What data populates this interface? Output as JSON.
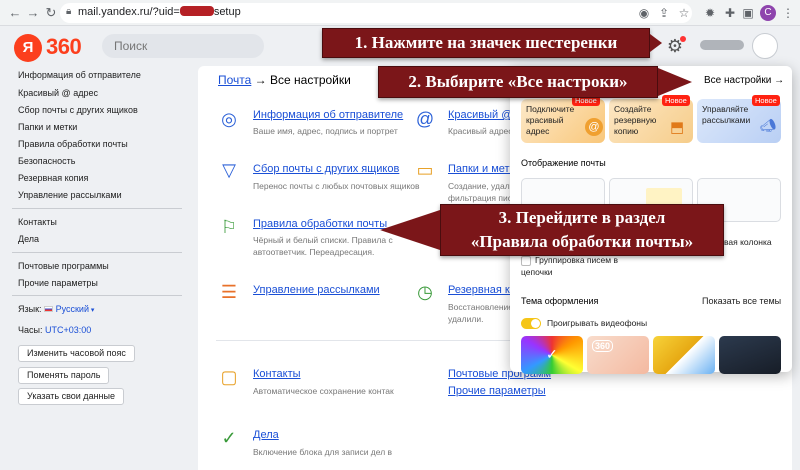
{
  "browser": {
    "url_prefix": "mail.yandex.ru/?uid=",
    "url_suffix": "setup",
    "profile_letter": "C"
  },
  "header": {
    "logo_letter": "Я",
    "logo_text": "360",
    "search_placeholder": "Поиск"
  },
  "sidebar": {
    "items": [
      "Информация об отправителе",
      "Красивый @ адрес",
      "Сбор почты с других ящиков",
      "Папки и метки",
      "Правила обработки почты",
      "Безопасность",
      "Резервная копия",
      "Управление рассылками"
    ],
    "items2": [
      "Контакты",
      "Дела"
    ],
    "items3": [
      "Почтовые программы",
      "Прочие параметры"
    ],
    "lang_label": "Язык:",
    "lang_value": "Русский",
    "tz_label": "Часы:",
    "tz_value": "UTC+03:00",
    "buttons": [
      "Изменить часовой пояс",
      "Поменять пароль",
      "Указать свои данные"
    ]
  },
  "breadcrumb": {
    "link": "Почта",
    "arrow": "→",
    "current": "Все настройки"
  },
  "settings": [
    {
      "title": "Информация об отправителе",
      "desc1": "Ваше имя, адрес, подпись и портрет",
      "desc2": ""
    },
    {
      "title": "Сбор почты с других ящиков",
      "desc1": "Перенос почты с любых почтовых ящиков",
      "desc2": ""
    },
    {
      "title": "Правила обработки почты",
      "desc1": "Чёрный и белый списки. Правила с",
      "desc2": "автоответчик. Переадресация."
    },
    {
      "title": "Управление рассылками",
      "desc1": "",
      "desc2": ""
    },
    {
      "title": "Контакты",
      "desc1": "Автоматическое сохранение контак",
      "desc2": ""
    },
    {
      "title": "Дела",
      "desc1": "Включение блока для записи дел в",
      "desc2": ""
    }
  ],
  "settings_right": [
    {
      "title": "Красивый @",
      "desc1": "Красивый адрес на",
      "desc2": ""
    },
    {
      "title": "Папки и метк",
      "desc1": "Создание, удалени",
      "desc2": "фильтрация писем"
    },
    {
      "title": "Резервная ко",
      "desc1": "Восстановление пи",
      "desc2": "удалили."
    }
  ],
  "settings_links": [
    "Почтовые программ",
    "Прочие параметры"
  ],
  "popup": {
    "all_settings": "Все настройки",
    "all_arrow": "→",
    "cards": [
      {
        "text": "Подключите красивый адрес",
        "badge": "Новое"
      },
      {
        "text": "Создайте резервную копию",
        "badge": "Новое"
      },
      {
        "text": "Управляйте рассылками",
        "badge": "Новое"
      }
    ],
    "mail_display_heading": "Отображение почты",
    "column_label": "вая колонка",
    "grouping_label1": "Группировка писем в",
    "grouping_label2": "цепочки",
    "theme_heading": "Тема оформления",
    "show_all_themes": "Показать все темы",
    "video_label": "Проигрывать видеофоны",
    "theme_360_label": "360"
  },
  "callouts": {
    "step1": "1. Нажмите на значек шестеренки",
    "step2": "2. Выбирите «Все настроки»",
    "step3_line1": "3. Перейдите в раздел",
    "step3_line2": "«Правила обработки почты»"
  },
  "colors": {
    "callout_bg": "#7b1619",
    "brand": "#fc3f1d",
    "link": "#1a4fd6",
    "badge": "#f21"
  },
  "icons": [
    "back-icon",
    "forward-icon",
    "reload-icon",
    "lock-icon",
    "share-icon",
    "star-icon",
    "gear-icon",
    "puzzle-icon",
    "split-icon"
  ]
}
